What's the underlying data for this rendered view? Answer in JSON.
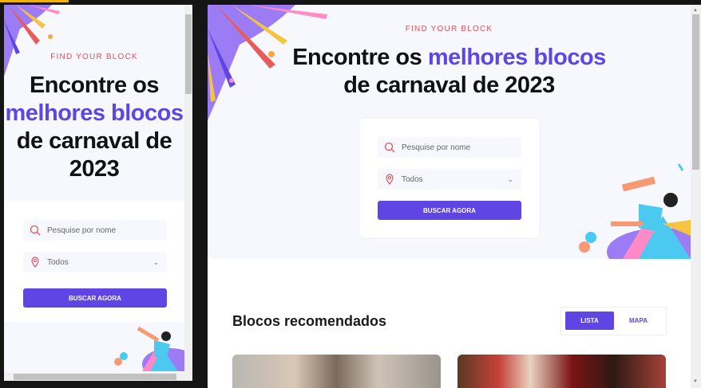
{
  "hero": {
    "eyebrow": "FIND YOUR BLOCK",
    "title_part1": "Encontre os ",
    "title_highlight": "melhores blocos",
    "title_part2": "de carnaval de 2023",
    "mobile_line1": "Encontre os",
    "mobile_line3": "de carnaval de",
    "mobile_line4": "2023"
  },
  "search": {
    "placeholder": "Pesquise por nome",
    "location_value": "Todos",
    "button_label": "BUSCAR AGORA"
  },
  "recommended": {
    "heading": "Blocos recomendados",
    "view_toggle": {
      "list_label": "LISTA",
      "map_label": "MAPA",
      "selected": "LISTA"
    }
  },
  "colors": {
    "accent": "#5f45e3",
    "eyebrow": "#e0525a",
    "hero_bg": "#f7f8fd"
  },
  "icons": [
    "search-icon",
    "map-pin-icon",
    "chevron-down-icon"
  ]
}
